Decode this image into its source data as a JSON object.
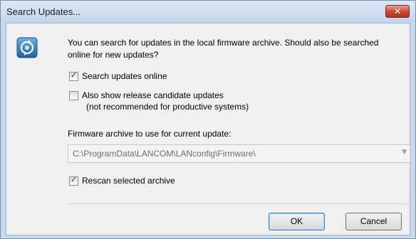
{
  "window": {
    "title": "Search Updates...",
    "close_label": "×"
  },
  "dialog": {
    "intro_text": "You can search for updates in the local firmware archive. Should also be searched online for new updates?",
    "search_online": {
      "label": "Search updates online",
      "checked": true
    },
    "release_candidates": {
      "label": "Also show release candidate updates",
      "sublabel": "(not recommended for productive systems)",
      "checked": false
    },
    "archive_label": "Firmware archive to use for current update:",
    "archive_path": "C:\\ProgramData\\LANCOM\\LANconfig\\Firmware\\",
    "rescan": {
      "label": "Rescan selected archive",
      "checked": true
    }
  },
  "buttons": {
    "ok_label": "OK",
    "cancel_label": "Cancel"
  },
  "icons": {
    "app": "refresh-globe-icon",
    "dropdown": "chevron-down-icon"
  },
  "colors": {
    "title_bar": "#c4d6ec",
    "close_button": "#c7493a",
    "dialog_bg": "#f0f0f0"
  }
}
